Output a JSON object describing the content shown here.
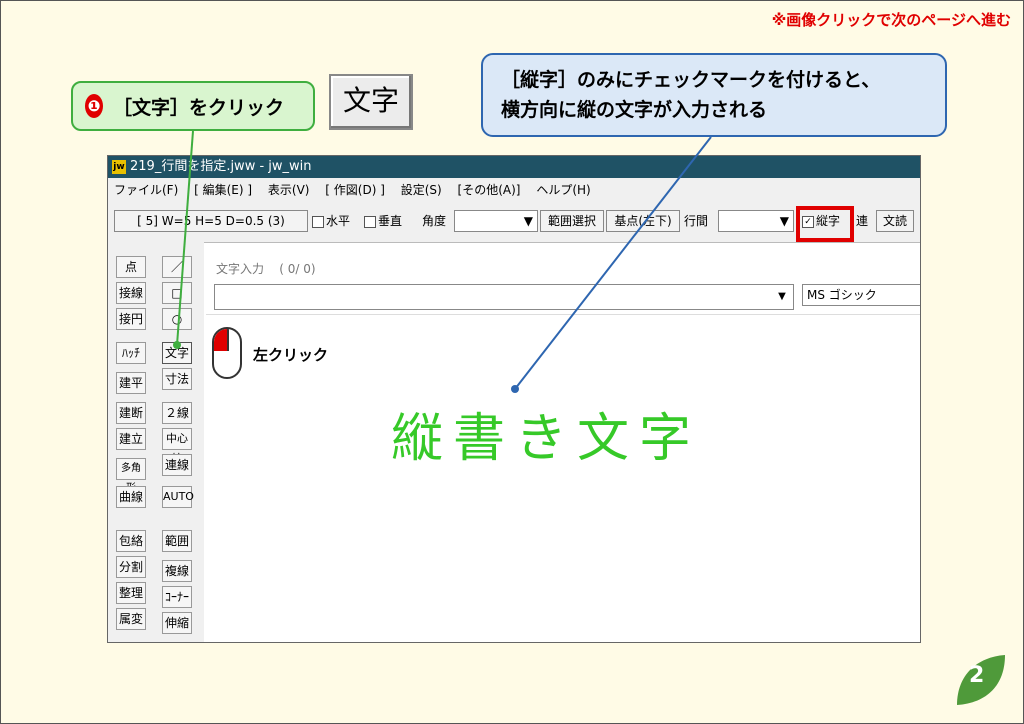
{
  "note": "※画像クリックで次のページへ進む",
  "callout1": {
    "step": "❶",
    "text": "［文字］をクリック"
  },
  "big_button": "文字",
  "callout2": {
    "line1": "［縦字］のみにチェックマークを付けると、",
    "line2": "横方向に縦の文字が入力される"
  },
  "window": {
    "title": "219_行間を指定.jww - jw_win",
    "icon": "jw"
  },
  "menu": [
    "ファイル(F)",
    "[ 編集(E) ]",
    "表示(V)",
    "[ 作図(D) ]",
    "設定(S)",
    "[その他(A)]",
    "ヘルプ(H)"
  ],
  "toolbar": {
    "font_setting": "[ 5]  W=5 H=5 D=0.5 (3)",
    "horizontal": "水平",
    "vertical": "垂直",
    "angle": "角度",
    "range_select": "範囲選択",
    "base_point": "基点(左下)",
    "line_spacing": "行間",
    "vertical_text": "縦字",
    "vertical_text_check": "✓",
    "continuous": "連",
    "text_read": "文読"
  },
  "left_tools": {
    "col1": [
      "点",
      "接線",
      "接円",
      "ﾊｯﾁ",
      "建平",
      "建断",
      "建立",
      "多角形",
      "曲線",
      "包絡",
      "分割",
      "整理",
      "属変"
    ],
    "col2": [
      "／",
      "□",
      "○",
      "文字",
      "寸法",
      "２線",
      "中心線",
      "連線",
      "AUTO",
      "範囲",
      "複線",
      "ｺｰﾅｰ",
      "伸縮"
    ]
  },
  "text_input": {
    "label": "文字入力",
    "count": "(  0/  0)",
    "value": "",
    "font": "MS ゴシック"
  },
  "canvas_text": "縦書き文字",
  "mouse_label": "左クリック",
  "page_number": "2"
}
